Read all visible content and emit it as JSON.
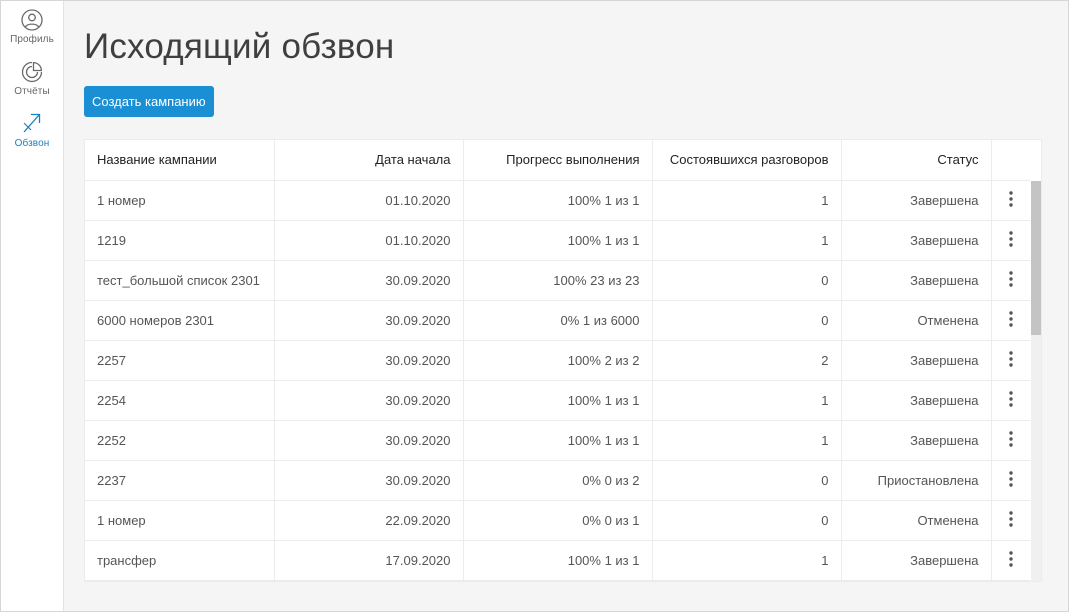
{
  "sidebar": {
    "items": [
      {
        "label": "Профиль",
        "icon": "user-icon",
        "active": false
      },
      {
        "label": "Отчёты",
        "icon": "pie-chart-icon",
        "active": false
      },
      {
        "label": "Обзвон",
        "icon": "outgoing-call-icon",
        "active": true
      }
    ]
  },
  "page": {
    "title": "Исходящий обзвон",
    "create_button": "Создать кампанию"
  },
  "table": {
    "headers": [
      "Название кампании",
      "Дата начала",
      "Прогресс выполнения",
      "Состоявшихся разговоров",
      "Статус"
    ],
    "rows": [
      {
        "name": "1 номер",
        "date": "01.10.2020",
        "progress": "100% 1 из 1",
        "calls": "1",
        "status": "Завершена"
      },
      {
        "name": "1219",
        "date": "01.10.2020",
        "progress": "100% 1 из 1",
        "calls": "1",
        "status": "Завершена"
      },
      {
        "name": "тест_большой список 2301",
        "date": "30.09.2020",
        "progress": "100% 23 из 23",
        "calls": "0",
        "status": "Завершена"
      },
      {
        "name": "6000 номеров 2301",
        "date": "30.09.2020",
        "progress": "0% 1 из 6000",
        "calls": "0",
        "status": "Отменена"
      },
      {
        "name": "2257",
        "date": "30.09.2020",
        "progress": "100% 2 из 2",
        "calls": "2",
        "status": "Завершена"
      },
      {
        "name": "2254",
        "date": "30.09.2020",
        "progress": "100% 1 из 1",
        "calls": "1",
        "status": "Завершена"
      },
      {
        "name": "2252",
        "date": "30.09.2020",
        "progress": "100% 1 из 1",
        "calls": "1",
        "status": "Завершена"
      },
      {
        "name": "2237",
        "date": "30.09.2020",
        "progress": "0% 0 из 2",
        "calls": "0",
        "status": "Приостановлена"
      },
      {
        "name": "1 номер",
        "date": "22.09.2020",
        "progress": "0% 0 из 1",
        "calls": "0",
        "status": "Отменена"
      },
      {
        "name": "трансфер",
        "date": "17.09.2020",
        "progress": "100% 1 из 1",
        "calls": "1",
        "status": "Завершена"
      }
    ]
  },
  "colors": {
    "accent": "#1a8fd4",
    "active_nav": "#1a7fc1"
  }
}
